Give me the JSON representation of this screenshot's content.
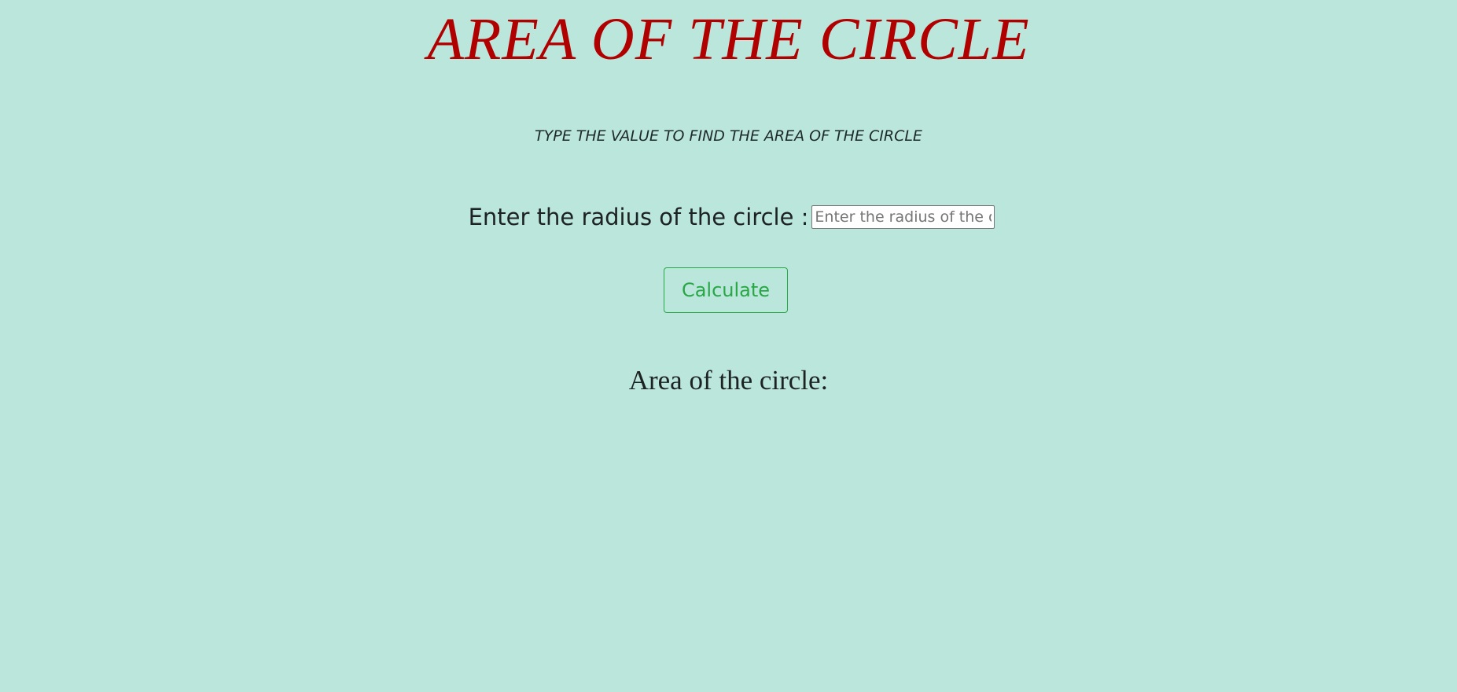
{
  "page": {
    "title": "AREA OF THE CIRCLE",
    "subtitle": "TYPE THE VALUE TO FIND THE AREA OF THE CIRCLE"
  },
  "form": {
    "radius_label": "Enter the radius of the circle :",
    "radius_input": {
      "value": "",
      "placeholder": "Enter the radius of the circle"
    },
    "calculate_label": "Calculate"
  },
  "result": {
    "label": "Area of the circle:"
  },
  "colors": {
    "background": "#bae6dc",
    "title": "#b00000",
    "button_accent": "#28a745",
    "text": "#1d2222"
  }
}
